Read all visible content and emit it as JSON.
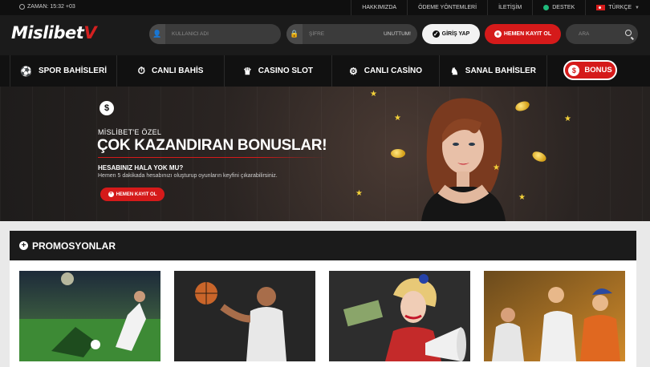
{
  "topbar": {
    "time": "ZAMAN: 15:32 +03",
    "links": [
      "HAKKIMIZDA",
      "ÖDEME YÖNTEMLERİ",
      "İLETİŞİM"
    ],
    "support": "DESTEK",
    "language": "TÜRKÇE"
  },
  "header": {
    "logo_main": "Mislibet",
    "logo_mark": "V",
    "username_placeholder": "KULLANICI ADI",
    "password_placeholder": "ŞİFRE",
    "forgot": "UNUTTUM!",
    "login": "GİRİŞ YAP",
    "register": "HEMEN KAYIT OL",
    "search_placeholder": "ARA"
  },
  "nav": {
    "items": [
      {
        "label": "SPOR BAHİSLERİ",
        "icon": "soccer-ball-icon"
      },
      {
        "label": "CANLI BAHİS",
        "icon": "stopwatch-icon"
      },
      {
        "label": "CASINO SLOT",
        "icon": "crown-icon"
      },
      {
        "label": "CANLI CASİNO",
        "icon": "chip-icon"
      },
      {
        "label": "SANAL BAHİSLER",
        "icon": "horse-icon"
      }
    ],
    "bonus": "BONUS"
  },
  "banner": {
    "pre_title": "MİSLİBET'E ÖZEL",
    "headline": "ÇOK KAZANDIRAN BONUSLAR!",
    "question": "HESABINIZ HALA YOK MU?",
    "description": "Hemen 5 dakikada hesabınızı oluşturup oyunların keyfini çıkarabilirsiniz.",
    "cta": "HEMEN KAYIT OL"
  },
  "promotions": {
    "title": "PROMOSYONLAR"
  },
  "colors": {
    "brand_red": "#d51a1a",
    "dark": "#1b1b1b"
  }
}
